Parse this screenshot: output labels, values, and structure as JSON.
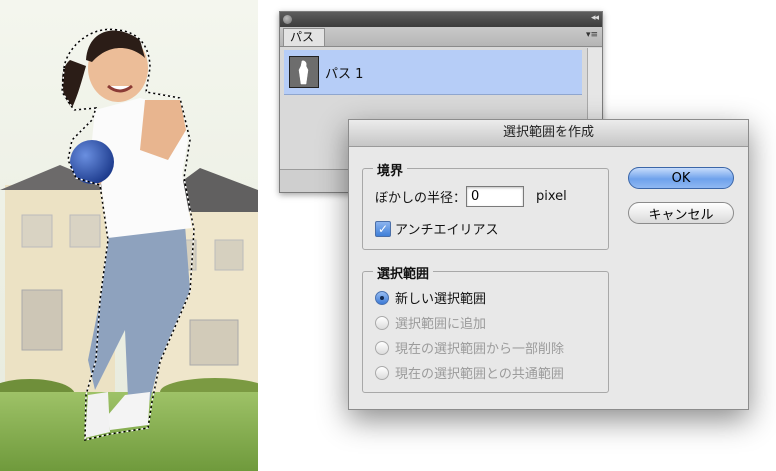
{
  "paths_panel": {
    "tab_label": "パス",
    "path_item_label": "パス 1",
    "collapse_glyph": "◂◂",
    "menu_glyph": "▾≡"
  },
  "dialog": {
    "title": "選択範囲を作成",
    "rendering": {
      "group_title": "境界",
      "feather_label": "ぼかしの半径：",
      "feather_value": "0",
      "feather_unit": "pixel",
      "antialias_label": "アンチエイリアス",
      "antialias_checked": true
    },
    "operation": {
      "group_title": "選択範囲",
      "options": [
        {
          "label": "新しい選択範囲",
          "selected": true,
          "enabled": true
        },
        {
          "label": "選択範囲に追加",
          "selected": false,
          "enabled": false
        },
        {
          "label": "現在の選択範囲から一部削除",
          "selected": false,
          "enabled": false
        },
        {
          "label": "現在の選択範囲との共通範囲",
          "selected": false,
          "enabled": false
        }
      ]
    },
    "ok_label": "OK",
    "cancel_label": "キャンセル"
  },
  "colors": {
    "path_row_highlight": "#b6cdf7",
    "ok_button": "#6fa2ec",
    "dialog_background": "#e8e8e8"
  }
}
